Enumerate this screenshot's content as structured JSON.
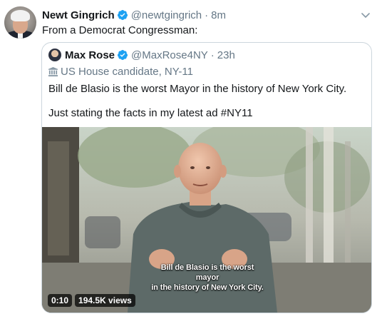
{
  "tweet": {
    "author_name": "Newt Gingrich",
    "author_handle": "@newtgingrich",
    "separator": "·",
    "time": "8m",
    "text": "From a Democrat Congressman:"
  },
  "quoted": {
    "author_name": "Max Rose",
    "author_handle": "@MaxRose4NY",
    "separator": "·",
    "time": "23h",
    "bio": "US House candidate, NY-11",
    "line1": "Bill de Blasio is the worst Mayor in the history of New York City.",
    "line2": "Just stating the facts in my latest ad #NY11",
    "video": {
      "caption_line1": "Bill de Blasio is the worst mayor",
      "caption_line2": "in the history of New York City.",
      "duration": "0:10",
      "views": "194.5K views"
    }
  },
  "icons": {
    "verified": "verified-badge-icon",
    "chevron": "chevron-down-icon",
    "building": "building-icon"
  },
  "colors": {
    "verified": "#1da1f2",
    "secondary_text": "#657786",
    "border": "#ccd6dd"
  }
}
